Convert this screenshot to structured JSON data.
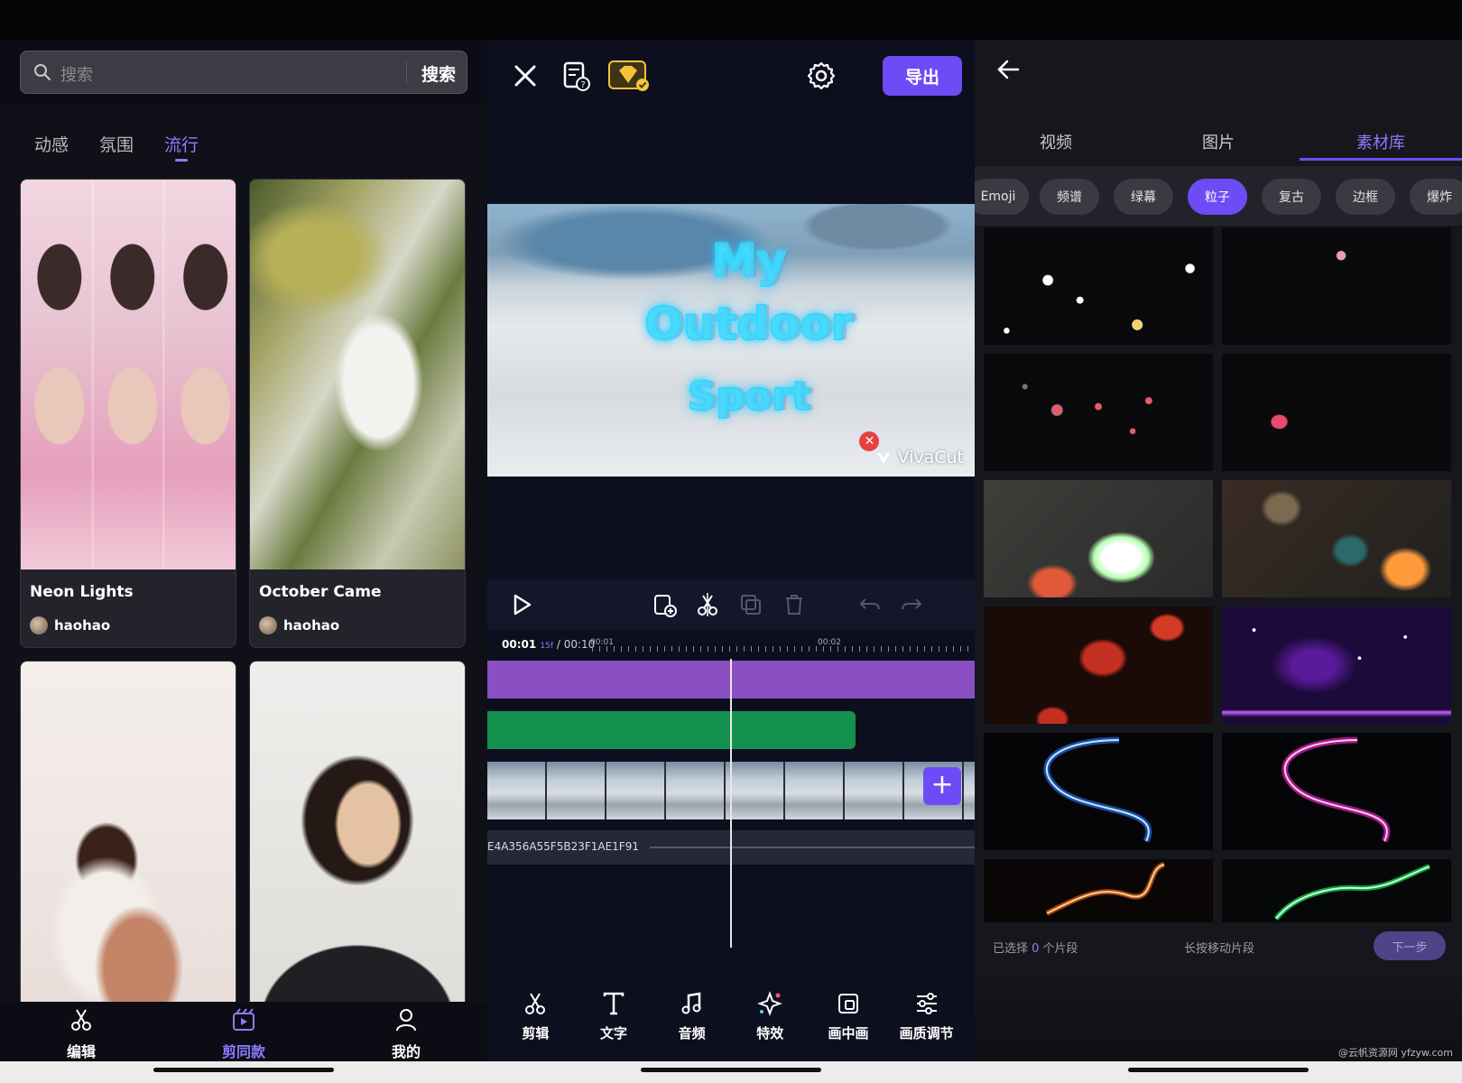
{
  "screen1": {
    "search": {
      "placeholder": "搜索",
      "button": "搜索"
    },
    "categories": [
      "动感",
      "氛围",
      "流行"
    ],
    "active_category": "流行",
    "cards": [
      {
        "title": "Neon Lights",
        "author": "haohao"
      },
      {
        "title": "October Came",
        "author": "haohao"
      },
      {
        "title": "",
        "author": ""
      },
      {
        "title": "",
        "author": ""
      }
    ],
    "nav": [
      {
        "label": "编辑",
        "icon": "scissors-icon"
      },
      {
        "label": "剪同款",
        "icon": "template-icon"
      },
      {
        "label": "我的",
        "icon": "profile-icon"
      }
    ],
    "active_nav": "剪同款"
  },
  "screen2": {
    "export_label": "导出",
    "preview": {
      "line1": "My",
      "line2": "Outdoor",
      "line3": "Sport",
      "watermark": "VivaCut"
    },
    "time": {
      "current": "00:01",
      "frame": "15f",
      "total": " / 00:10",
      "mark1": "00:01",
      "mark2": "00:02"
    },
    "audio_label": "E4A356A55F5B23F1AE1F91",
    "tools": [
      {
        "label": "剪辑",
        "icon": "scissors-icon"
      },
      {
        "label": "文字",
        "icon": "text-icon"
      },
      {
        "label": "音频",
        "icon": "music-note-icon"
      },
      {
        "label": "特效",
        "icon": "sparkle-icon"
      },
      {
        "label": "画中画",
        "icon": "picture-in-picture-icon"
      },
      {
        "label": "画质调节",
        "icon": "sliders-icon"
      }
    ],
    "colors": {
      "accent": "#6d4cf5",
      "track_purple": "#8a4fc2",
      "track_green": "#15914e"
    }
  },
  "screen3": {
    "tabs": [
      "视频",
      "图片",
      "素材库"
    ],
    "active_tab": "素材库",
    "chips": [
      "Emoji",
      "频谱",
      "绿幕",
      "粒子",
      "复古",
      "边框",
      "爆炸"
    ],
    "active_chip": "粒子",
    "selection": {
      "prefix": "已选择 ",
      "count": "0",
      "suffix": " 个片段"
    },
    "hint": "长按移动片段",
    "next_label": "下一步",
    "credit": "@云帆资源网 yfzyw.com"
  }
}
